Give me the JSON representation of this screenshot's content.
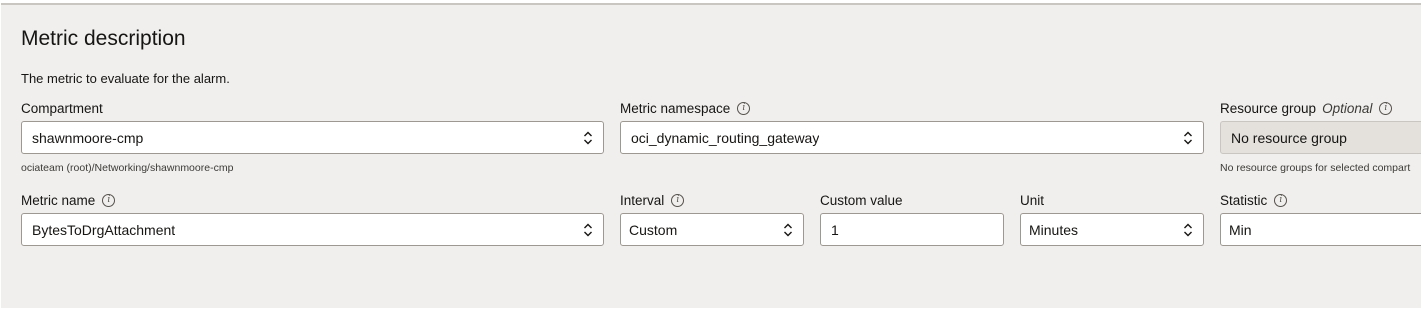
{
  "section": {
    "title": "Metric description",
    "description": "The metric to evaluate for the alarm."
  },
  "compartment": {
    "label": "Compartment",
    "value": "shawnmoore-cmp",
    "hint": "ociateam (root)/Networking/shawnmoore-cmp"
  },
  "metric_namespace": {
    "label": "Metric namespace",
    "value": "oci_dynamic_routing_gateway"
  },
  "resource_group": {
    "label": "Resource group",
    "optional": "Optional",
    "value": "No resource group",
    "hint": "No resource groups for selected compart"
  },
  "metric_name": {
    "label": "Metric name",
    "value": "BytesToDrgAttachment"
  },
  "interval": {
    "label": "Interval",
    "value": "Custom"
  },
  "custom_value": {
    "label": "Custom value",
    "value": "1"
  },
  "unit": {
    "label": "Unit",
    "value": "Minutes"
  },
  "statistic": {
    "label": "Statistic",
    "value": "Min"
  },
  "icons": {
    "info": "info-icon",
    "select": "chevron-up-down-icon"
  },
  "colors": {
    "panel_bg": "#f1efed",
    "field_border": "#9e9892",
    "disabled_bg": "#e4e1dd"
  }
}
